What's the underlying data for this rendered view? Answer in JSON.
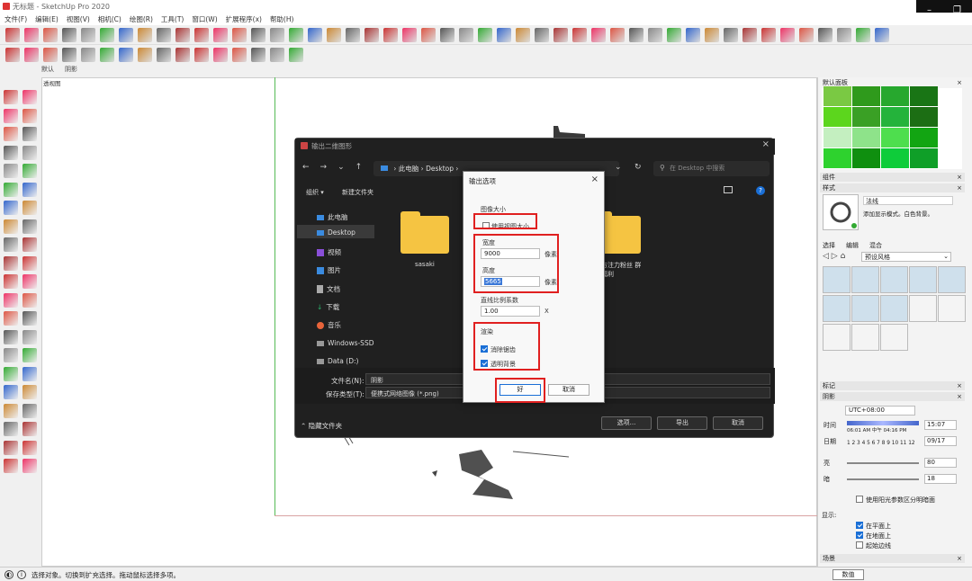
{
  "window": {
    "title": "无标题 - SketchUp Pro 2020"
  },
  "menu": [
    "文件(F)",
    "编辑(E)",
    "视图(V)",
    "相机(C)",
    "绘图(R)",
    "工具(T)",
    "窗口(W)",
    "扩展程序(x)",
    "帮助(H)"
  ],
  "scene_tabs": [
    "默认",
    "阴影"
  ],
  "viewport": {
    "label": "透视图"
  },
  "status": {
    "text": "选择对象。切换到扩充选择。拖动鼠标选择多项。"
  },
  "right_panel": {
    "title": "默认面板",
    "sections": {
      "components": "组件",
      "styles": "样式",
      "tags": "标记",
      "shadows": "阴影",
      "scenes": "场景"
    },
    "style": {
      "name": "法线",
      "desc": "添加显示模式。白色背景。",
      "tabs": [
        "选择",
        "编辑",
        "混合"
      ],
      "dropdown": "预设风格"
    },
    "shadow": {
      "tz": "UTC+08:00",
      "time_label": "时间",
      "time_scale": "06:01 AM  中午  04:16 PM",
      "time_value": "15:07",
      "date_label": "日期",
      "date_scale": "1 2 3 4 5 6 7 8 9 10 11 12",
      "date_value": "09/17",
      "light_label": "亮",
      "light_value": "80",
      "dark_label": "暗",
      "dark_value": "18",
      "sun_check": "使用阳光参数区分明暗面",
      "display_label": "显示:",
      "on_faces": "在平面上",
      "on_ground": "在地面上",
      "from_edges": "起始边线"
    },
    "bottom_tab": "数值"
  },
  "explorer": {
    "title": "输出二维图形",
    "path": [
      "此电脑",
      "Desktop"
    ],
    "search_placeholder": "在 Desktop 中搜索",
    "organize": "组织 ▾",
    "new_folder": "新建文件夹",
    "tree": [
      "此电脑",
      "Desktop",
      "视频",
      "图片",
      "文档",
      "下载",
      "音乐",
      "Windows-SSD",
      "Data (D:)"
    ],
    "folders": [
      "sasaki",
      "方注力粉丝 群福利"
    ],
    "filename_label": "文件名(N):",
    "filename_value": "阴影",
    "filetype_label": "保存类型(T):",
    "filetype_value": "便携式网络图像 (*.png)",
    "hide_folders": "隐藏文件夹",
    "btn_options": "选项...",
    "btn_export": "导出",
    "btn_cancel": "取消"
  },
  "export_options": {
    "title": "输出选项",
    "section_size": "图像大小",
    "use_view_size": "使用视图大小",
    "width_label": "宽度",
    "width_value": "9000",
    "height_label": "高度",
    "height_value": "5665",
    "unit": "像素",
    "ratio_label": "直线比例系数",
    "ratio_value": "1.00",
    "ratio_unit": "X",
    "section_render": "渲染",
    "antialias": "消除锯齿",
    "transparent": "透明背景",
    "ok": "好",
    "cancel": "取消"
  },
  "colors": {
    "accent": "#e02020",
    "green1": "#5cc51d",
    "green2": "#2f9a1c",
    "green3": "#197515",
    "green4": "#a8e0a0"
  }
}
